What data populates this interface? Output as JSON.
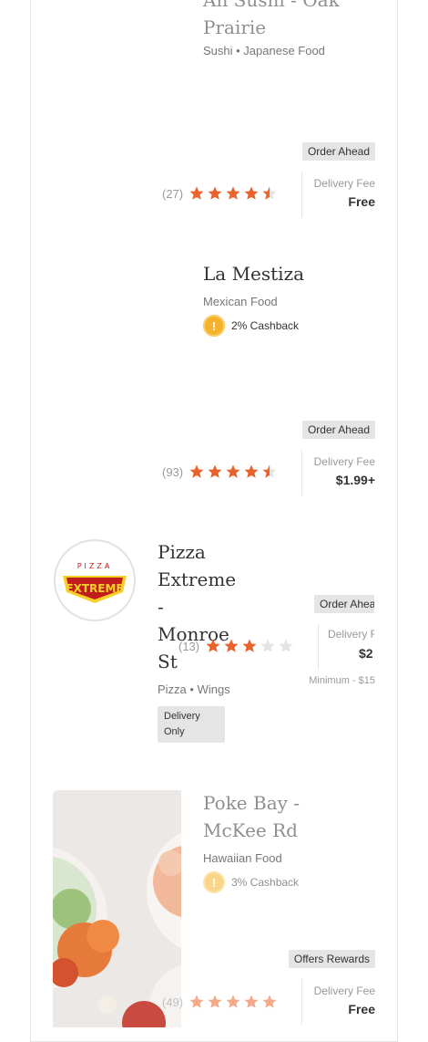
{
  "restaurants": [
    {
      "name": "Ah Sushi - Oak Prairie",
      "name_lines": [
        "Ah Sushi - Oak",
        "Prairie"
      ],
      "category": "Sushi • Japanese Food",
      "tag": "Order Ahead",
      "rating_count": "(27)",
      "rating": 4.5,
      "fee_label": "Delivery Fee",
      "fee_value": "Free"
    },
    {
      "name": "La Mestiza",
      "category": "Mexican Food",
      "cashback": "2% Cashback",
      "tag": "Order Ahead",
      "rating_count": "(93)",
      "rating": 4.5,
      "fee_label": "Delivery Fee",
      "fee_value": "$1.99+"
    },
    {
      "name": "Pizza Extreme - Monroe St",
      "name_lines": [
        "Pizza",
        "Extreme",
        "-",
        "Monroe",
        "St"
      ],
      "category": "Pizza • Wings",
      "badge": "Delivery Only",
      "badge_lines": [
        "Delivery",
        "Only"
      ],
      "tag": "Order Ahead",
      "rating_count": "(13)",
      "rating": 3,
      "fee_label": "Delivery Fee",
      "fee_value": "$2",
      "minimum": "Minimum - $15",
      "logo_text": "PIZZA EXTREME"
    },
    {
      "name": "Poke Bay - McKee Rd",
      "name_lines": [
        "Poke Bay -",
        "McKee Rd"
      ],
      "category": "Hawaiian Food",
      "cashback": "3% Cashback",
      "tag": "Offers Rewards",
      "rating_count": "(49)",
      "rating": 5,
      "fee_label": "Delivery Fee",
      "fee_value": "Free"
    }
  ],
  "colors": {
    "star": "#e8632b",
    "star_empty": "#e3e3e3",
    "coin": "#f6b22a"
  }
}
